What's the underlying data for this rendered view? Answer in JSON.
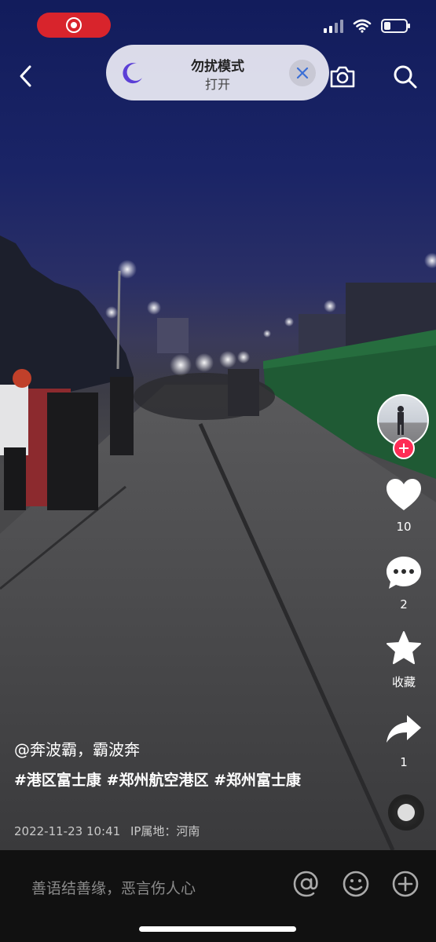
{
  "status_bar": {
    "battery_level": 0.3
  },
  "dnd_banner": {
    "title": "勿扰模式",
    "subtitle": "打开"
  },
  "video": {
    "author": "@奔波霸，霸波奔",
    "tags": "#港区富士康 #郑州航空港区 #郑州富士康",
    "timestamp": "2022-11-23 10:41",
    "ip_location": "IP属地：河南"
  },
  "actions": {
    "like_count": "10",
    "comment_count": "2",
    "favorite_label": "收藏",
    "share_count": "1"
  },
  "comment_bar": {
    "placeholder": "善语结善缘，恶言伤人心"
  },
  "colors": {
    "accent": "#fe2c55",
    "record": "#d8242c",
    "moon": "#5b3fd6"
  },
  "icons": [
    "back-icon",
    "camera-icon",
    "search-icon",
    "moon-icon",
    "close-icon",
    "heart-icon",
    "comment-icon",
    "star-icon",
    "share-icon",
    "at-icon",
    "emoji-icon",
    "add-icon"
  ]
}
